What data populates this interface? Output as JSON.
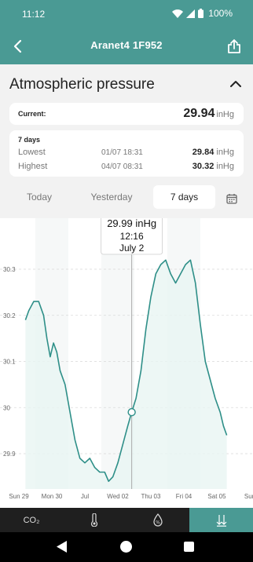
{
  "status_bar": {
    "time": "11:12",
    "battery": "100%"
  },
  "app_bar": {
    "title": "Aranet4 1F952",
    "back_icon": "chevron-left-icon",
    "share_icon": "share-icon"
  },
  "section": {
    "title": "Atmospheric pressure",
    "collapse_icon": "chevron-up-icon"
  },
  "current": {
    "label": "Current:",
    "value": "29.94",
    "unit": "inHg"
  },
  "stats": {
    "period": "7 days",
    "lowest": {
      "label": "Lowest",
      "date": "01/07 18:31",
      "value": "29.84",
      "unit": "inHg"
    },
    "highest": {
      "label": "Highest",
      "date": "04/07 08:31",
      "value": "30.32",
      "unit": "inHg"
    }
  },
  "tabs": {
    "today": "Today",
    "yesterday": "Yesterday",
    "seven_days": "7 days",
    "selected": "7 days",
    "calendar_icon": "calendar-icon"
  },
  "tooltip": {
    "value": "29.99 inHg",
    "time": "12:16",
    "date": "July 2"
  },
  "bottom_nav": {
    "co2": "CO₂",
    "temperature_icon": "thermometer-icon",
    "humidity_icon": "humidity-icon",
    "pressure_icon": "pressure-arrows-icon",
    "selected": "pressure"
  },
  "colors": {
    "accent": "#4a9a94",
    "line": "#2e8f88",
    "fill": "#e9f5f3"
  },
  "chart_data": {
    "type": "line",
    "title": "",
    "xlabel": "",
    "ylabel": "",
    "y_ticks": [
      "30.3",
      "30.2",
      "30.1",
      "30",
      "29.9"
    ],
    "y_tick_values": [
      30.3,
      30.2,
      30.1,
      30.0,
      29.9
    ],
    "x_ticks": [
      "Sun 29",
      "Mon 30",
      "Jul",
      "Wed 02",
      "Thu 03",
      "Fri 04",
      "Sat 05",
      "Sun"
    ],
    "x_tick_positions": [
      0,
      1,
      2,
      3,
      4,
      5,
      6,
      7
    ],
    "xlim": [
      0,
      7
    ],
    "ylim": [
      29.8,
      30.42
    ],
    "grid": true,
    "series": [
      {
        "x": [
          0.2,
          0.3,
          0.45,
          0.6,
          0.75,
          0.85,
          0.95,
          1.05,
          1.15,
          1.25,
          1.4,
          1.55,
          1.7,
          1.85,
          2.0,
          2.15,
          2.3,
          2.45,
          2.6,
          2.72,
          2.85,
          3.0,
          3.15,
          3.3,
          3.42,
          3.55,
          3.7,
          3.85,
          4.0,
          4.15,
          4.3,
          4.45,
          4.6,
          4.75,
          4.9,
          5.05,
          5.2,
          5.35,
          5.5,
          5.65,
          5.8,
          5.95,
          6.1,
          6.2,
          6.3
        ],
        "values": [
          30.19,
          30.21,
          30.23,
          30.23,
          30.2,
          30.15,
          30.11,
          30.14,
          30.12,
          30.08,
          30.05,
          29.99,
          29.93,
          29.89,
          29.88,
          29.89,
          29.87,
          29.86,
          29.86,
          29.84,
          29.85,
          29.88,
          29.92,
          29.96,
          29.99,
          30.02,
          30.08,
          30.17,
          30.24,
          30.29,
          30.31,
          30.32,
          30.29,
          30.27,
          30.29,
          30.31,
          30.32,
          30.27,
          30.18,
          30.1,
          30.06,
          30.02,
          29.99,
          29.96,
          29.94
        ]
      }
    ],
    "highlight": {
      "x": 3.42,
      "value": 29.99
    }
  }
}
